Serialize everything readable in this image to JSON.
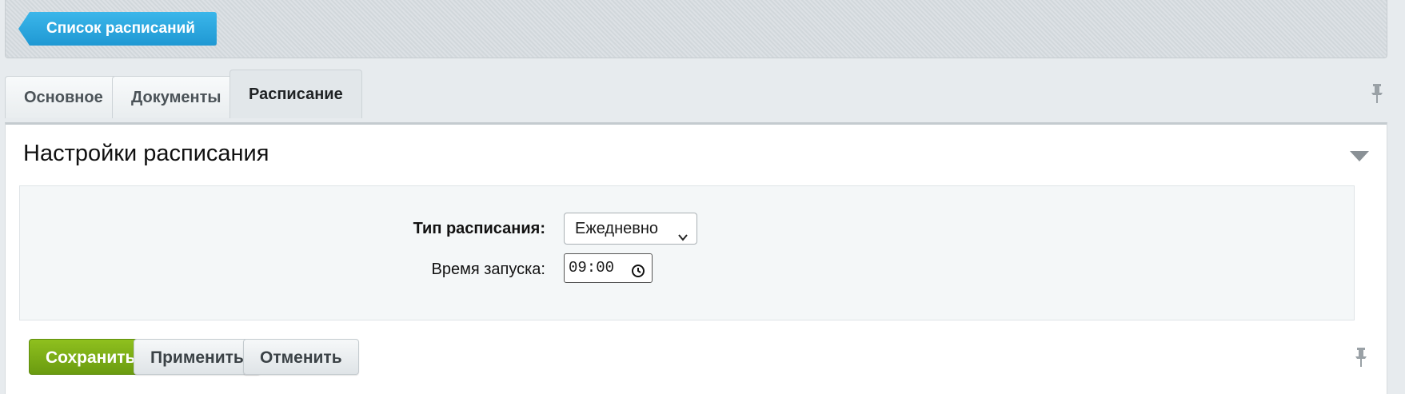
{
  "toolbar": {
    "back_label": "Список расписаний"
  },
  "tabs": [
    {
      "label": "Основное",
      "active": false
    },
    {
      "label": "Документы",
      "active": false
    },
    {
      "label": "Расписание",
      "active": true
    }
  ],
  "section": {
    "title": "Настройки расписания"
  },
  "form": {
    "schedule_type_label": "Тип расписания:",
    "schedule_type_value": "Ежедневно",
    "start_time_label": "Время запуска:",
    "start_time_value": "09:00"
  },
  "actions": {
    "save_label": "Сохранить",
    "apply_label": "Применить",
    "cancel_label": "Отменить"
  },
  "icons": {
    "pin": "pin-icon",
    "collapse": "triangle-down-icon",
    "select_chevron": "chevron-down-icon",
    "clock": "clock-icon"
  },
  "colors": {
    "back_button": "#1f98d3",
    "save_button": "#7aad16",
    "toolbar_bg": "#d5dbdf",
    "form_bg": "#f4f7f8"
  }
}
